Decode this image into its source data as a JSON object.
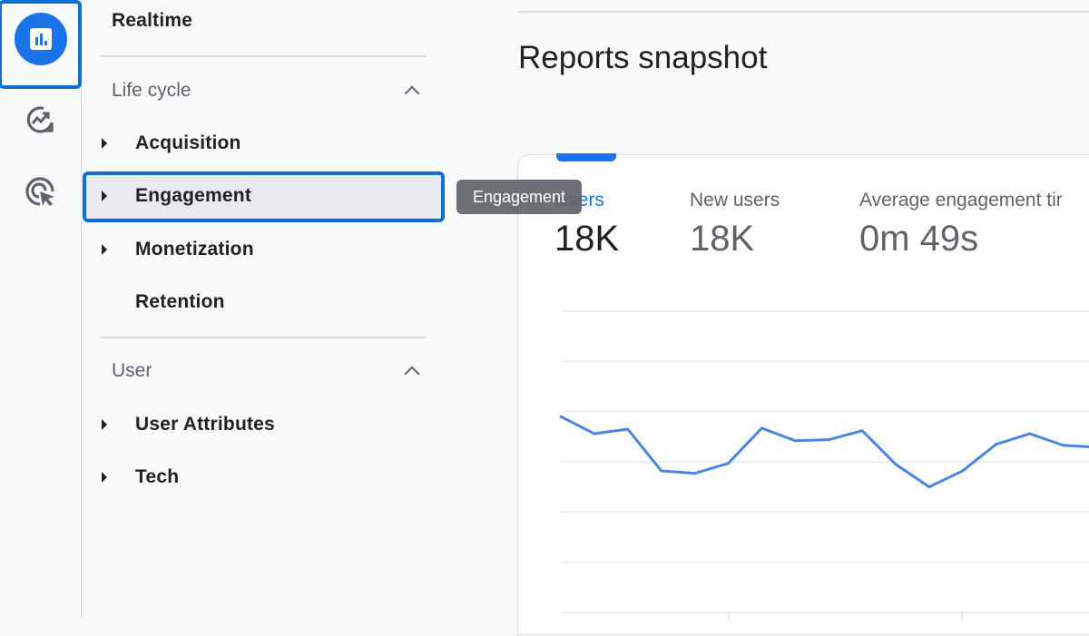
{
  "rail": {
    "items": [
      {
        "name": "reports",
        "icon": "bar-chart-icon",
        "active": true
      },
      {
        "name": "explore",
        "icon": "explore-trend-icon",
        "active": false
      },
      {
        "name": "advertising",
        "icon": "target-cursor-icon",
        "active": false
      }
    ],
    "accent": "#1a73e8",
    "focus_outline": "#0b6fd6"
  },
  "nav": {
    "realtime": "Realtime",
    "sections": [
      {
        "title": "Life cycle",
        "expanded": true,
        "items": [
          {
            "label": "Acquisition",
            "expandable": true
          },
          {
            "label": "Engagement",
            "expandable": true,
            "selected": true
          },
          {
            "label": "Monetization",
            "expandable": true
          },
          {
            "label": "Retention",
            "expandable": false
          }
        ]
      },
      {
        "title": "User",
        "expanded": true,
        "items": [
          {
            "label": "User Attributes",
            "expandable": true
          },
          {
            "label": "Tech",
            "expandable": true
          }
        ]
      }
    ]
  },
  "tooltip": "Engagement",
  "main": {
    "title": "Reports snapshot",
    "metrics": [
      {
        "label": "Users",
        "value": "18K",
        "active": true
      },
      {
        "label": "New users",
        "value": "18K",
        "active": false
      },
      {
        "label": "Average engagement tir",
        "value": "0m 49s",
        "active": false
      }
    ]
  },
  "chart_data": {
    "type": "line",
    "title": "",
    "xlabel": "",
    "ylabel": "",
    "note": "No axis tick labels visible; y values expressed in gridline units (0 = bottom gridline, 6 = top gridline), read from the plot.",
    "x": [
      1,
      2,
      3,
      4,
      5,
      6,
      7,
      8,
      9,
      10,
      11,
      12,
      13,
      14,
      15,
      16,
      17
    ],
    "series": [
      {
        "name": "Users",
        "color": "#4a86e0",
        "values": [
          3.9,
          3.56,
          3.65,
          2.82,
          2.77,
          2.97,
          3.67,
          3.42,
          3.44,
          3.62,
          2.95,
          2.5,
          2.82,
          3.35,
          3.56,
          3.33,
          3.29
        ]
      }
    ],
    "ylim": [
      0,
      6
    ],
    "gridlines": 7,
    "grid": true,
    "legend": "none"
  }
}
